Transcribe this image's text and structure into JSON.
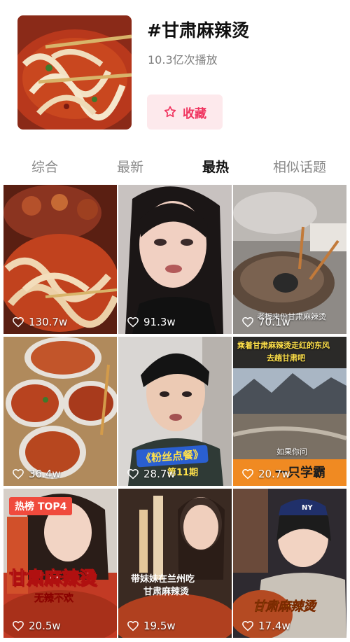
{
  "topic": {
    "title": "#甘肃麻辣烫",
    "play_count": "10.3亿次播放",
    "favorite_label": "收藏"
  },
  "tabs": [
    {
      "label": "综合",
      "active": false
    },
    {
      "label": "最新",
      "active": false
    },
    {
      "label": "最热",
      "active": true
    },
    {
      "label": "相似话题",
      "active": false
    }
  ],
  "videos": [
    {
      "likes": "130.7w"
    },
    {
      "likes": "91.3w"
    },
    {
      "likes": "70.1w",
      "caption": "老板来份甘肃麻辣烫"
    },
    {
      "likes": "36.4w"
    },
    {
      "likes": "28.7w",
      "banner": "《粉丝点餐》",
      "banner_sub": "第11期"
    },
    {
      "likes": "20.7w",
      "caption_top": "乘着甘肃麻辣烫走红的东风",
      "caption_top2": "去趟甘肃吧",
      "caption_mid": "如果你问",
      "logo_text": "一只学霸"
    },
    {
      "likes": "20.5w",
      "badge": "热榜 TOP4",
      "big_text": "甘肃麻辣烫",
      "sub_text": "无辣不欢"
    },
    {
      "likes": "19.5w",
      "caption_1": "带妹妹在兰州吃",
      "caption_2": "甘肃麻辣烫"
    },
    {
      "likes": "17.4w",
      "big_text": "甘肃麻辣烫",
      "cap_logo": "NY"
    }
  ],
  "colors": {
    "accent": "#f0345f",
    "accent_bg": "#fde9ec",
    "badge": "#f04a3d"
  }
}
